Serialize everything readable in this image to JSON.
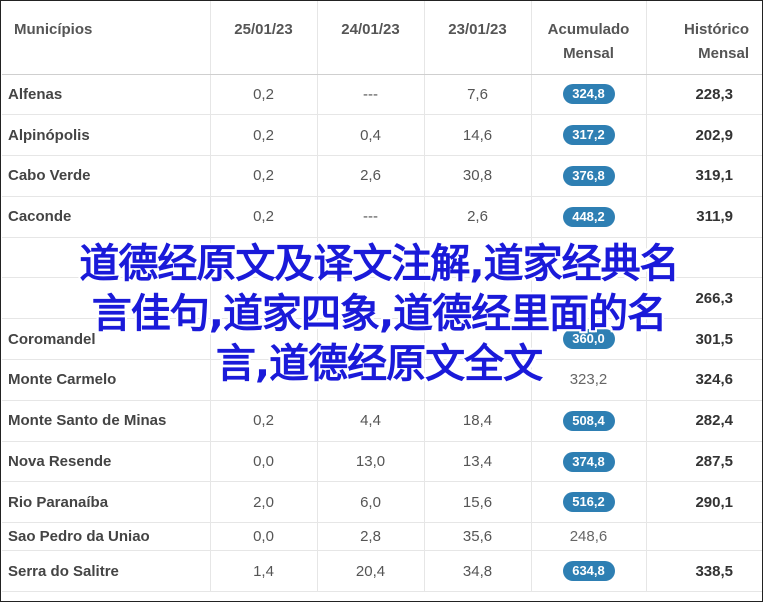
{
  "headers": {
    "municipio": "Municípios",
    "d1": "25/01/23",
    "d2": "24/01/23",
    "d3": "23/01/23",
    "acumulado_1": "Acumulado",
    "acumulado_2": "Mensal",
    "historico_1": "Histórico",
    "historico_2": "Mensal"
  },
  "rows": [
    {
      "municipio": "Alfenas",
      "d1": "0,2",
      "d2": "---",
      "d3": "7,6",
      "acumulado": "324,8",
      "badge": true,
      "historico": "228,3"
    },
    {
      "municipio": "Alpinópolis",
      "d1": "0,2",
      "d2": "0,4",
      "d3": "14,6",
      "acumulado": "317,2",
      "badge": true,
      "historico": "202,9"
    },
    {
      "municipio": "Cabo Verde",
      "d1": "0,2",
      "d2": "2,6",
      "d3": "30,8",
      "acumulado": "376,8",
      "badge": true,
      "historico": "319,1"
    },
    {
      "municipio": "Caconde",
      "d1": "0,2",
      "d2": "---",
      "d3": "2,6",
      "acumulado": "448,2",
      "badge": true,
      "historico": "311,9"
    },
    {
      "municipio": "",
      "d1": "",
      "d2": "",
      "d3": "",
      "acumulado": "",
      "badge": false,
      "historico": ""
    },
    {
      "municipio": "",
      "d1": "",
      "d2": "",
      "d3": "",
      "acumulado": "",
      "badge": false,
      "historico": "266,3"
    },
    {
      "municipio": "Coromandel",
      "d1": "",
      "d2": "",
      "d3": "",
      "acumulado": "360,0",
      "badge": true,
      "historico": "301,5"
    },
    {
      "municipio": "Monte Carmelo",
      "d1": "",
      "d2": "",
      "d3": "",
      "acumulado": "323,2",
      "badge": false,
      "historico": "324,6"
    },
    {
      "municipio": "Monte Santo de Minas",
      "d1": "0,2",
      "d2": "4,4",
      "d3": "18,4",
      "acumulado": "508,4",
      "badge": true,
      "historico": "282,4"
    },
    {
      "municipio": "Nova Resende",
      "d1": "0,0",
      "d2": "13,0",
      "d3": "13,4",
      "acumulado": "374,8",
      "badge": true,
      "historico": "287,5"
    },
    {
      "municipio": "Rio Paranaíba",
      "d1": "2,0",
      "d2": "6,0",
      "d3": "15,6",
      "acumulado": "516,2",
      "badge": true,
      "historico": "290,1"
    },
    {
      "municipio": "Sao Pedro da Uniao",
      "d1": "0,0",
      "d2": "2,8",
      "d3": "35,6",
      "acumulado": "248,6",
      "badge": false,
      "historico": ""
    },
    {
      "municipio": "Serra do Salitre",
      "d1": "1,4",
      "d2": "20,4",
      "d3": "34,8",
      "acumulado": "634,8",
      "badge": true,
      "historico": "338,5"
    }
  ],
  "overlay": {
    "line1": "道德经原文及译文注解,道家经典名",
    "line2": "言佳句,道家四象,道德经里面的名",
    "line3": "言,道德经原文全文"
  },
  "colors": {
    "badge": "#2e7fb3",
    "overlay_text": "#1a1ad9"
  }
}
